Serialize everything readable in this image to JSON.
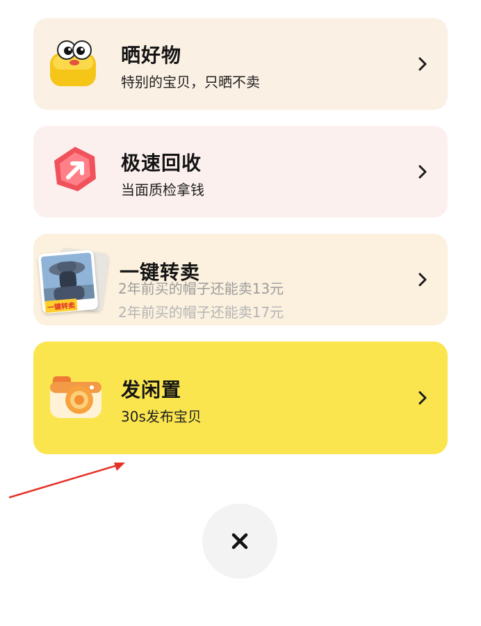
{
  "menu": {
    "items": [
      {
        "title": "晒好物",
        "subtitle": "特别的宝贝，只晒不卖"
      },
      {
        "title": "极速回收",
        "subtitle": "当面质检拿钱"
      },
      {
        "title": "一键转卖",
        "subtitle_lines": [
          "2年前买的帽子还能卖13元",
          "2年前买的帽子还能卖17元"
        ],
        "thumbnail_label": "一键转卖"
      },
      {
        "title": "发闲置",
        "subtitle": "30s发布宝贝"
      }
    ]
  },
  "colors": {
    "card_show": "#fbf0e4",
    "card_recycle": "#fcf0ee",
    "card_resell": "#fcf1df",
    "card_publish": "#fbe54f",
    "close_button_bg": "#f3f3f3",
    "annotation_arrow": "#e53227"
  },
  "icons": {
    "show": "yellow-cartoon-eyes-icon",
    "recycle": "red-hexagon-arrow-icon",
    "resell": "hat-photo-thumbnail",
    "publish": "camera-icon",
    "chevron": "chevron-right-icon",
    "close": "close-icon"
  }
}
